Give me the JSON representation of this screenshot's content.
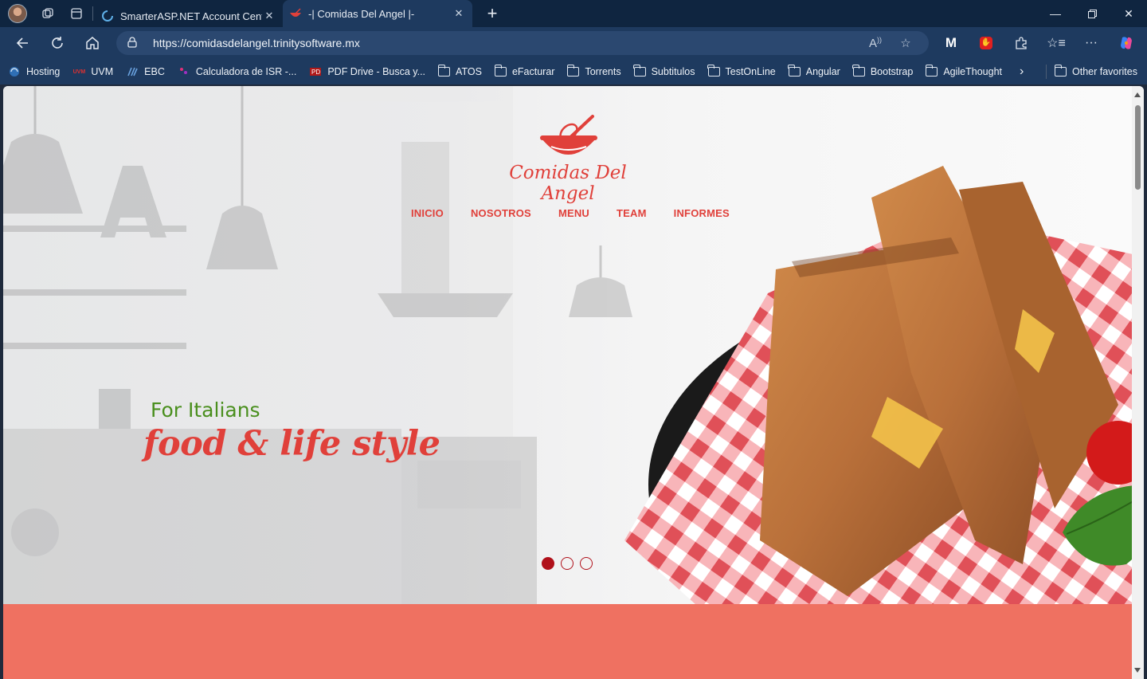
{
  "browser": {
    "tabs": [
      {
        "title": "SmarterASP.NET Account Center",
        "active": false
      },
      {
        "title": "-| Comidas Del Angel |-",
        "active": true
      }
    ],
    "url": "https://comidasdelangel.trinitysoftware.mx",
    "bookmarks": [
      {
        "label": "Hosting",
        "type": "site"
      },
      {
        "label": "UVM",
        "type": "site"
      },
      {
        "label": "EBC",
        "type": "site"
      },
      {
        "label": "Calculadora de ISR -...",
        "type": "site"
      },
      {
        "label": "PDF Drive - Busca y...",
        "type": "site"
      },
      {
        "label": "ATOS",
        "type": "folder"
      },
      {
        "label": "eFacturar",
        "type": "folder"
      },
      {
        "label": "Torrents",
        "type": "folder"
      },
      {
        "label": "Subtitulos",
        "type": "folder"
      },
      {
        "label": "TestOnLine",
        "type": "folder"
      },
      {
        "label": "Angular",
        "type": "folder"
      },
      {
        "label": "Bootstrap",
        "type": "folder"
      },
      {
        "label": "AgileThought",
        "type": "folder"
      }
    ],
    "other_favorites": "Other favorites"
  },
  "site": {
    "brand": "Comidas Del Angel",
    "nav": [
      "INICIO",
      "NOSOTROS",
      "MENU",
      "TEAM",
      "INFORMES"
    ],
    "slide": {
      "kicker": "For Italians",
      "headline": "food & life style"
    },
    "carousel": {
      "count": 3,
      "active": 0
    },
    "colors": {
      "accent": "#e0403a",
      "green": "#4a8f1e",
      "band": "#ef7161",
      "dot": "#b0101a"
    }
  }
}
